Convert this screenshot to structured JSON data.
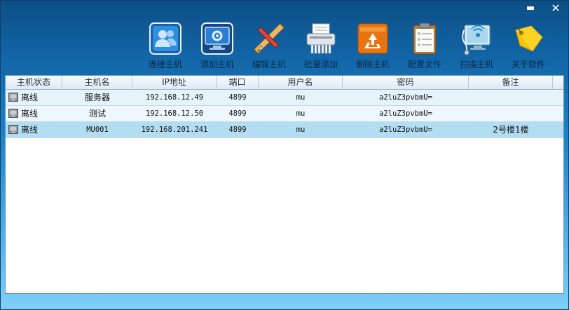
{
  "window": {
    "minimize_glyph": "▬",
    "close_glyph": "✕"
  },
  "toolbar": [
    {
      "label": "连接主机",
      "icon": "connect-users-icon"
    },
    {
      "label": "添加主机",
      "icon": "add-monitor-icon"
    },
    {
      "label": "编辑主机",
      "icon": "pencil-ruler-icon"
    },
    {
      "label": "批量添加",
      "icon": "shredder-icon"
    },
    {
      "label": "删除主机",
      "icon": "recycle-bin-icon"
    },
    {
      "label": "配置文件",
      "icon": "clipboard-icon"
    },
    {
      "label": "扫描主机",
      "icon": "scan-monitor-icon"
    },
    {
      "label": "关于软件",
      "icon": "tag-icon"
    }
  ],
  "table": {
    "columns": [
      "主机状态",
      "主机名",
      "IP地址",
      "端口",
      "用户名",
      "密码",
      "备注"
    ],
    "rows": [
      {
        "status": "离线",
        "hostname": "服务器",
        "ip": "192.168.12.49",
        "port": "4899",
        "user": "mu",
        "password": "a2luZ3pvbmU=",
        "note": ""
      },
      {
        "status": "离线",
        "hostname": "测试",
        "ip": "192.168.12.50",
        "port": "4899",
        "user": "mu",
        "password": "a2luZ3pvbmU=",
        "note": ""
      },
      {
        "status": "离线",
        "hostname": "MU001",
        "ip": "192.168.201.241",
        "port": "4899",
        "user": "mu",
        "password": "a2luZ3pvbmU=",
        "note": "2号楼1楼"
      }
    ]
  }
}
